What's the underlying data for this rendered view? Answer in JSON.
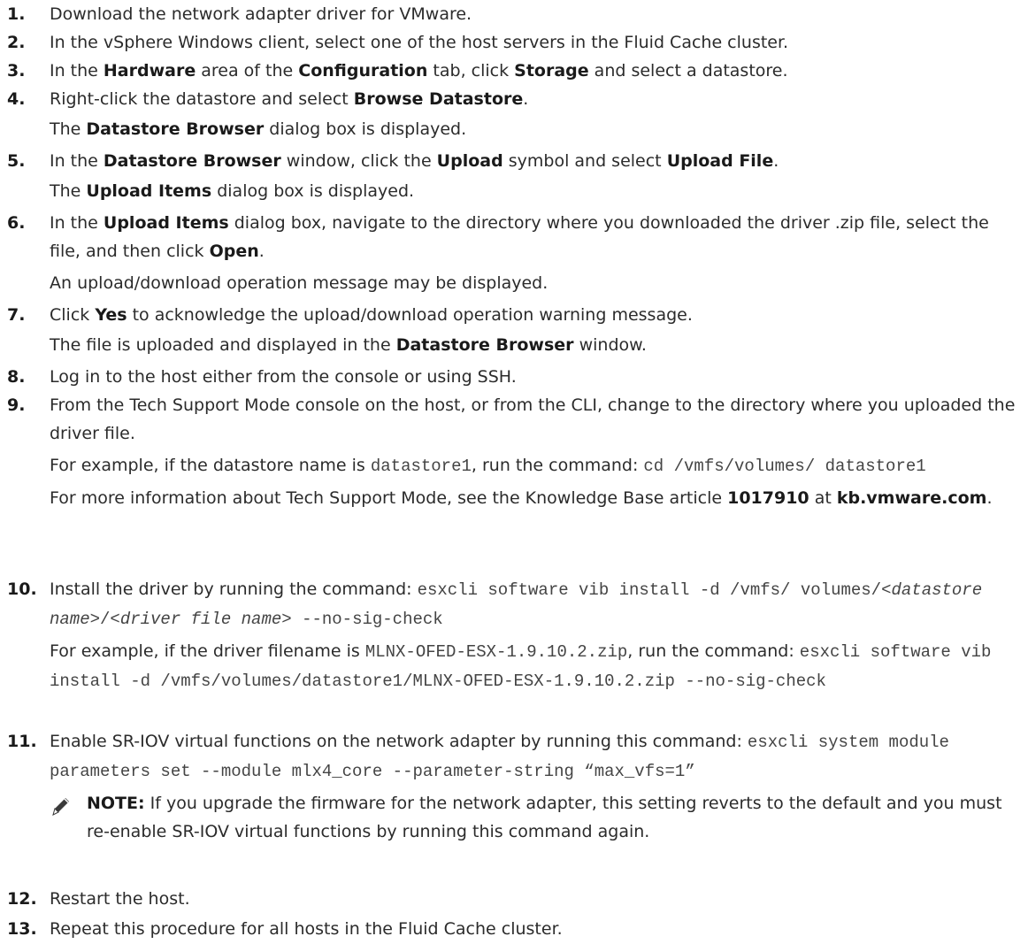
{
  "steps": [
    {
      "num": "1.",
      "runs": [
        {
          "t": "Download the network adapter driver for VMware."
        }
      ]
    },
    {
      "num": "2.",
      "runs": [
        {
          "t": "In the vSphere Windows client, select one of the host servers in the Fluid Cache cluster."
        }
      ]
    },
    {
      "num": "3.",
      "runs": [
        {
          "t": "In the "
        },
        {
          "t": "Hardware",
          "b": true
        },
        {
          "t": " area of the "
        },
        {
          "t": "Configuration",
          "b": true
        },
        {
          "t": " tab, click "
        },
        {
          "t": "Storage",
          "b": true
        },
        {
          "t": " and select a datastore."
        }
      ]
    },
    {
      "num": "4.",
      "runs": [
        {
          "t": "Right-click the datastore and select "
        },
        {
          "t": "Browse Datastore",
          "b": true
        },
        {
          "t": "."
        }
      ],
      "result": [
        {
          "t": "The "
        },
        {
          "t": "Datastore Browser",
          "b": true
        },
        {
          "t": " dialog box is displayed."
        }
      ]
    },
    {
      "num": "5.",
      "runs": [
        {
          "t": "In the "
        },
        {
          "t": "Datastore Browser",
          "b": true
        },
        {
          "t": " window, click the "
        },
        {
          "t": "Upload",
          "b": true
        },
        {
          "t": " symbol and select "
        },
        {
          "t": "Upload File",
          "b": true
        },
        {
          "t": "."
        }
      ],
      "result": [
        {
          "t": "The "
        },
        {
          "t": "Upload Items",
          "b": true
        },
        {
          "t": " dialog box is displayed."
        }
      ]
    },
    {
      "num": "6.",
      "runs": [
        {
          "t": "In the "
        },
        {
          "t": "Upload Items",
          "b": true
        },
        {
          "t": " dialog box, navigate to the directory where you downloaded the driver .zip file, select the file, and then click "
        },
        {
          "t": "Open",
          "b": true
        },
        {
          "t": "."
        }
      ],
      "result": [
        {
          "t": "An upload/download operation message may be displayed."
        }
      ]
    },
    {
      "num": "7.",
      "runs": [
        {
          "t": "Click "
        },
        {
          "t": "Yes",
          "b": true
        },
        {
          "t": " to acknowledge the upload/download operation warning message."
        }
      ],
      "result": [
        {
          "t": "The file is uploaded and displayed in the "
        },
        {
          "t": "Datastore Browser",
          "b": true
        },
        {
          "t": " window."
        }
      ]
    },
    {
      "num": "8.",
      "runs": [
        {
          "t": "Log in to the host either from the console or using SSH."
        }
      ]
    },
    {
      "num": "9.",
      "runs": [
        {
          "t": "From the Tech Support Mode console on the host, or from the CLI, change to the directory where you uploaded the driver file."
        }
      ],
      "result": [
        {
          "t": "For example, if the datastore name is "
        },
        {
          "t": "datastore1",
          "m": true
        },
        {
          "t": ", run the command: "
        },
        {
          "t": "cd /vmfs/volumes/ datastore1",
          "m": true
        }
      ],
      "result2": [
        {
          "t": "For more information about Tech Support Mode, see the Knowledge Base article "
        },
        {
          "t": "1017910",
          "b": true
        },
        {
          "t": " at "
        },
        {
          "t": "kb.vmware.com",
          "b": true
        },
        {
          "t": "."
        }
      ]
    },
    {
      "num": "10.",
      "runs": [
        {
          "t": "Install the driver by running the command: "
        },
        {
          "t": "esxcli software vib install -d /vmfs/ volumes/<",
          "m": true
        },
        {
          "t": "datastore name",
          "m": true,
          "i": true
        },
        {
          "t": ">/<",
          "m": true
        },
        {
          "t": "driver file name",
          "m": true,
          "i": true
        },
        {
          "t": "> --no-sig-check",
          "m": true
        }
      ],
      "result": [
        {
          "t": "For example, if the driver filename is "
        },
        {
          "t": "MLNX-OFED-ESX-1.9.10.2.zip",
          "m": true
        },
        {
          "t": ", run the command: "
        },
        {
          "t": "esxcli software vib install -d /vmfs/volumes/datastore1/MLNX-OFED-ESX-1.9.10.2.zip --no-sig-check",
          "m": true
        }
      ]
    },
    {
      "num": "11.",
      "runs": [
        {
          "t": "Enable SR-IOV virtual functions on the network adapter by running this command: "
        },
        {
          "t": "esxcli system module parameters set --module mlx4_core --parameter-string “max_vfs=1”",
          "m": true
        }
      ],
      "note": [
        {
          "t": "NOTE:",
          "b": true
        },
        {
          "t": " If you upgrade the firmware for the network adapter, this setting reverts to the default and you must re-enable SR-IOV virtual functions by running this command again."
        }
      ]
    },
    {
      "num": "12.",
      "runs": [
        {
          "t": "Restart the host."
        }
      ]
    },
    {
      "num": "13.",
      "runs": [
        {
          "t": "Repeat this procedure for all hosts in the Fluid Cache cluster."
        }
      ]
    }
  ]
}
